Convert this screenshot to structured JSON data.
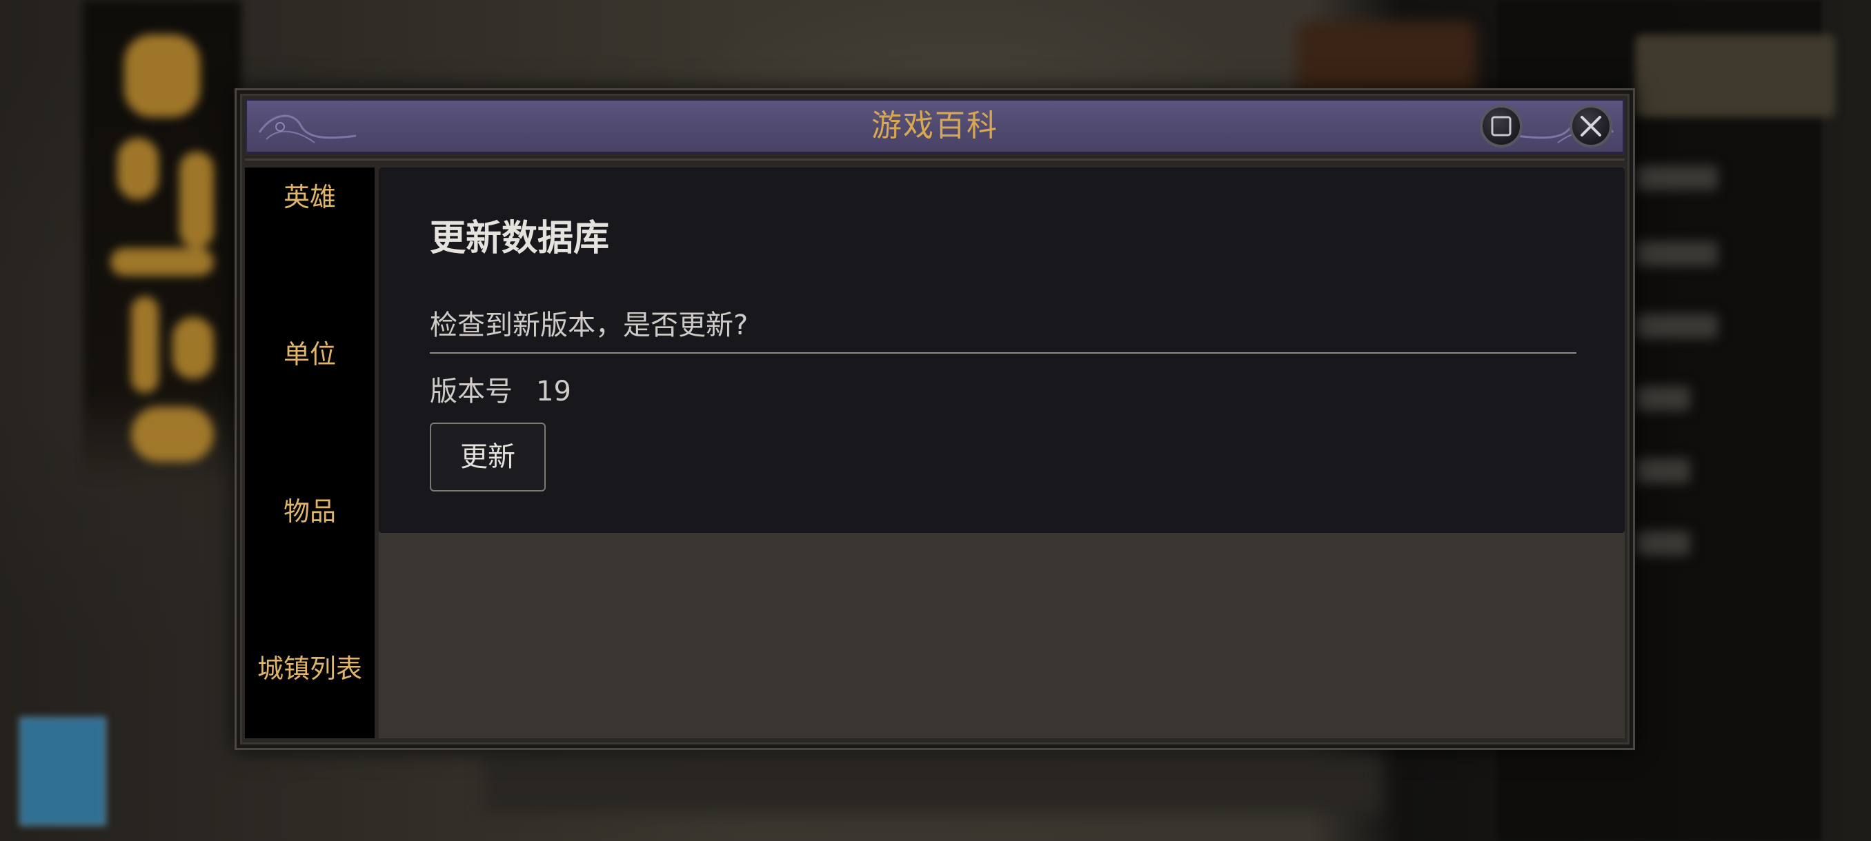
{
  "window": {
    "title": "游戏百科"
  },
  "sidebar": {
    "items": [
      {
        "label": "英雄"
      },
      {
        "label": "单位"
      },
      {
        "label": "物品"
      },
      {
        "label": "城镇列表"
      }
    ]
  },
  "content": {
    "title": "更新数据库",
    "question": "检查到新版本，是否更新?",
    "version_label": "版本号",
    "version_value": "19",
    "update_button": "更新"
  },
  "colors": {
    "title_gold": "#d7a752",
    "sidebar_text": "#e0b56a",
    "titlebar_purple": "#514a70",
    "card_bg": "#18171b"
  },
  "icons": {
    "maximize": "maximize-icon",
    "close": "close-icon"
  }
}
